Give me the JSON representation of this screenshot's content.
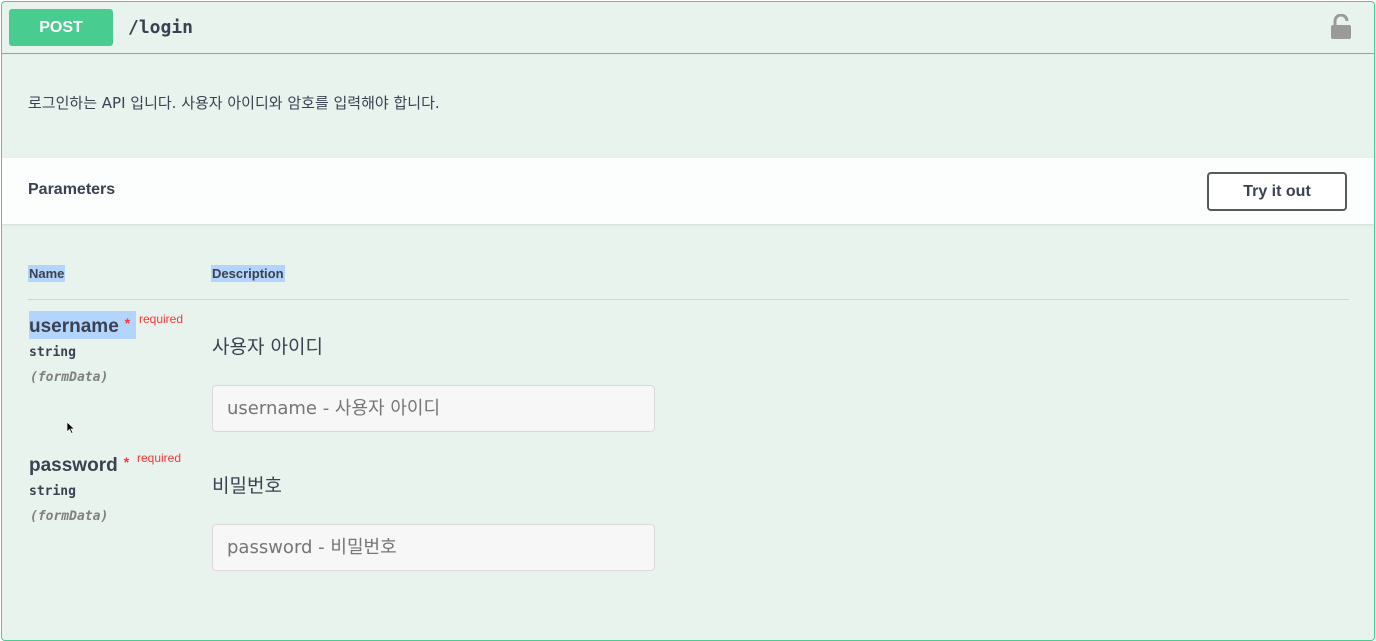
{
  "operation": {
    "method": "POST",
    "path": "/login",
    "description": "로그인하는 API 입니다. 사용자 아이디와 암호를 입력해야 합니다.",
    "lock_icon": "unlocked-lock-icon"
  },
  "parameters": {
    "title": "Parameters",
    "try_label": "Try it out",
    "col_name": "Name",
    "col_description": "Description",
    "items": [
      {
        "name": "username",
        "required_mark": "*",
        "required_label": "required",
        "type": "string",
        "in": "(formData)",
        "description": "사용자 아이디",
        "placeholder": "username - 사용자 아이디"
      },
      {
        "name": "password",
        "required_mark": "*",
        "required_label": "required",
        "type": "string",
        "in": "(formData)",
        "description": "비밀번호",
        "placeholder": "password - 비밀번호"
      }
    ]
  },
  "colors": {
    "post": "#49cc90",
    "background": "#e8f3ee",
    "required": "#ff3333",
    "selection": "#b3d4fc"
  }
}
